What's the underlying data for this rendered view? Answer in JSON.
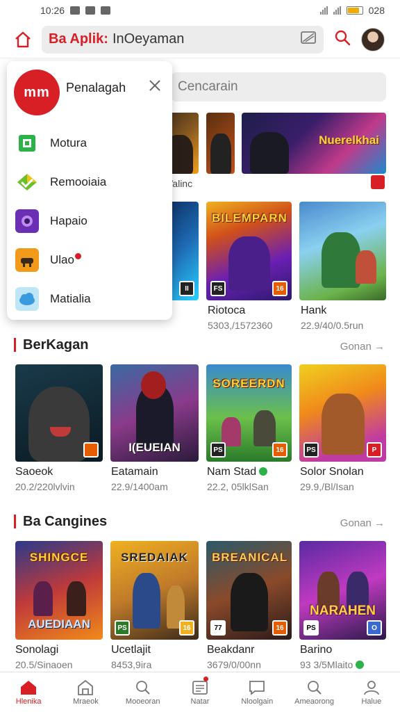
{
  "status_bar": {
    "time": "10:26",
    "battery_text": "028"
  },
  "header": {
    "title_red": "Ba Aplik:",
    "title_rest": "InOeyaman"
  },
  "search": {
    "placeholder": "Cencarain"
  },
  "dropdown": {
    "logo_text": "mm",
    "title": "Penalagah",
    "items": [
      {
        "label": "Motura",
        "icon": "green-square-icon",
        "color": "#2bb34a"
      },
      {
        "label": "Remooiaia",
        "icon": "green-diamond-icon",
        "color": "#6bbf2a"
      },
      {
        "label": "Hapaio",
        "icon": "purple-game-icon",
        "color": "#6b2fb3"
      },
      {
        "label": "Ulao",
        "icon": "orange-game-icon",
        "color": "#f29a1a"
      },
      {
        "label": "Matialia",
        "icon": "blue-cloud-icon",
        "color": "#4fb6e8"
      }
    ]
  },
  "featured": {
    "partial_label": "Valinc",
    "banner_text": "Nuerelkhai"
  },
  "top_grid": [
    {
      "name": "Riotoca",
      "meta": "5303,/1572360",
      "banner": "BILEMPARN"
    },
    {
      "name": "Hank",
      "meta": "22.9/40/0.5run"
    }
  ],
  "sections": [
    {
      "title": "BerKagan",
      "more": "Gonan →",
      "games": [
        {
          "name": "Saoeok",
          "meta": "20.2/220lvlvin"
        },
        {
          "name": "Eatamain",
          "meta": "22.9/1400am",
          "banner": "I(EUEIAN"
        },
        {
          "name": "Nam Stad",
          "meta": "22.2, 05lklSan",
          "banner": "SOREERDN",
          "verified": true
        },
        {
          "name": "Solor Snolan",
          "meta": "29.9,/Bl/Isan"
        }
      ]
    },
    {
      "title": "Ba Cangines",
      "more": "Gonan →",
      "games": [
        {
          "name": "Sonolagi",
          "meta": "20.5/Sinaoen",
          "banner": "SHINGCE",
          "banner2": "AUEDIAAN"
        },
        {
          "name": "Ucetlajit",
          "meta": "8453,9ira",
          "banner": "SREDAIAK"
        },
        {
          "name": "Beakdanr",
          "meta": "3679/0/00nn",
          "banner": "BREANICAL"
        },
        {
          "name": "Barino",
          "meta": "93 3/5Mlaito",
          "banner": "NARAHEN",
          "verified": true
        }
      ]
    }
  ],
  "bottom_nav": [
    {
      "label": "Hlenika",
      "icon": "home-icon",
      "active": true
    },
    {
      "label": "Mraeok",
      "icon": "store-icon"
    },
    {
      "label": "Mooeoran",
      "icon": "search-icon"
    },
    {
      "label": "Natar",
      "icon": "news-icon",
      "badge": true
    },
    {
      "label": "Nloolgain",
      "icon": "chat-icon"
    },
    {
      "label": "Ameaorong",
      "icon": "explore-icon"
    },
    {
      "label": "Halue",
      "icon": "profile-icon"
    }
  ]
}
